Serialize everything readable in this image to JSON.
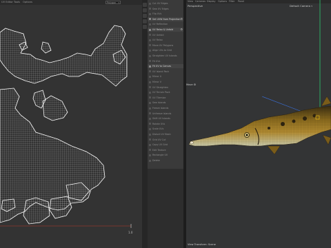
{
  "uv_editor": {
    "header_items": [
      "UV Editor",
      "Tools",
      "Options"
    ],
    "mode_select": "Polygon",
    "tick_label": "1.0"
  },
  "tool_menu": {
    "items": [
      {
        "label": "Cut UV Edges",
        "active": false
      },
      {
        "label": "Sew UV Edges",
        "active": false
      },
      {
        "label": "Flip UVs",
        "active": false
      },
      {
        "label": "Set UVW from Projection",
        "active": true,
        "gear": true
      },
      {
        "label": "UV Reflection",
        "active": false
      },
      {
        "label": "UV Relax & Unfold",
        "active": true,
        "gear": true
      },
      {
        "label": "UV Unfold",
        "active": false
      },
      {
        "label": "UV Relax",
        "active": false
      },
      {
        "label": "Move UV Polygons",
        "active": false
      },
      {
        "label": "Align UVs to Grid",
        "active": false
      },
      {
        "label": "Straighten UV Islands",
        "active": false
      },
      {
        "label": "Fit UVs",
        "active": false
      },
      {
        "label": "Fit UV to Canvas",
        "active": true
      },
      {
        "label": "UV Island Pack",
        "active": false
      },
      {
        "label": "Mirror U",
        "active": false
      },
      {
        "label": "Mirror V",
        "active": false
      },
      {
        "label": "UV Straighten",
        "active": false
      },
      {
        "label": "UV Terrain Pack",
        "active": false
      },
      {
        "label": "UV Tilemize",
        "active": false
      },
      {
        "label": "Sew Islands",
        "active": false
      },
      {
        "label": "Freeze Islands",
        "active": false
      },
      {
        "label": "Unfreeze Islands",
        "active": false
      },
      {
        "label": "Shift UV Islands",
        "active": false
      },
      {
        "label": "Rotate UVs",
        "active": false
      },
      {
        "label": "Scale UVs",
        "active": false
      },
      {
        "label": "Distort UV Mesh",
        "active": false
      },
      {
        "label": "Grid UV Cut",
        "active": false
      },
      {
        "label": "Copy UV Grid",
        "active": false
      },
      {
        "label": "Edit Texture",
        "active": false
      },
      {
        "label": "Rectangle UV",
        "active": false
      },
      {
        "label": "Delete",
        "active": false
      }
    ]
  },
  "viewport": {
    "menu_items": [
      "View",
      "Cameras",
      "Display",
      "Options",
      "Filter",
      "Panel"
    ],
    "title": "Perspective",
    "camera": "Default Camera",
    "move_label": "Move",
    "status": "View Transform: Scene"
  },
  "colors": {
    "uv_wire": "#e6e6e6",
    "axis_u": "#c0392b",
    "axis_y": "#2ecc71",
    "axis_z": "#3a6fd8",
    "fish_body": "#8a6a1e",
    "fish_belly": "#c9c9a8",
    "fish_dark": "#3b2e12"
  }
}
